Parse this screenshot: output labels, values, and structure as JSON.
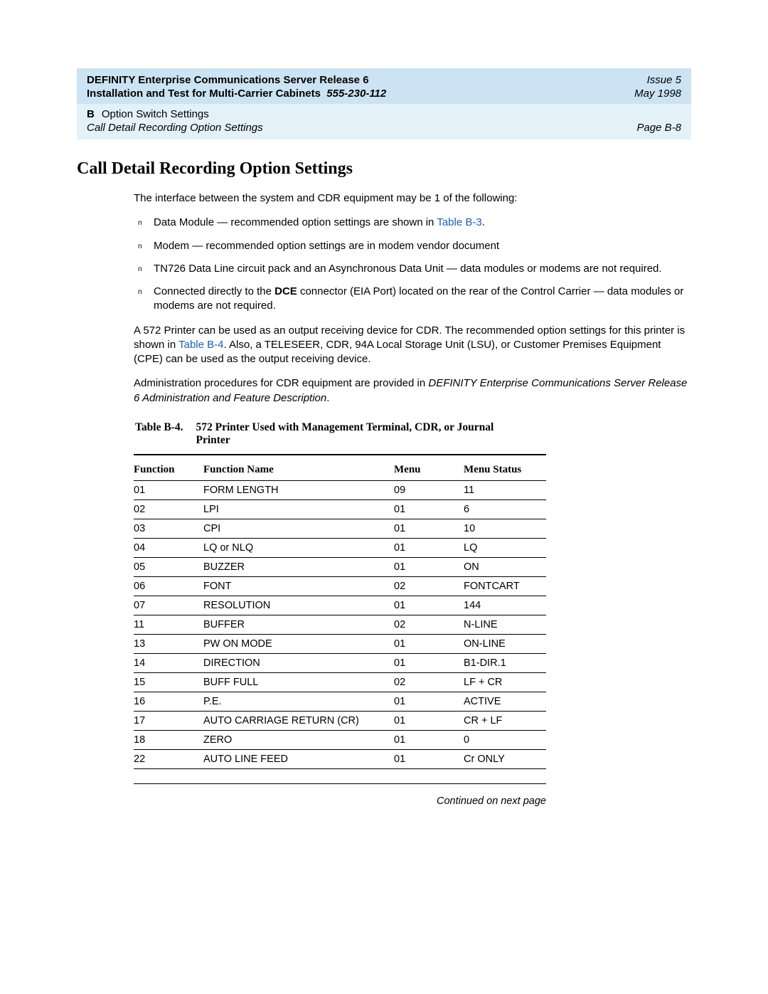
{
  "header": {
    "title_main": "DEFINITY Enterprise Communications Server Release 6",
    "issue": "Issue 5",
    "subtitle": "Installation and Test for Multi-Carrier Cabinets",
    "docnum": "555-230-112",
    "date": "May 1998",
    "appendix_letter": "B",
    "appendix_title": "Option Switch Settings",
    "breadcrumb": "Call Detail Recording Option Settings",
    "page": "Page B-8"
  },
  "section_title": "Call Detail Recording Option Settings",
  "intro_p": "The interface between the system and CDR equipment may be 1 of the following:",
  "bullets": [
    {
      "prefix": "Data Module",
      "dash": " — ",
      "rest_a": "recommended option settings are shown in ",
      "link": "Table B-3",
      "rest_b": "."
    },
    {
      "prefix": "Modem",
      "dash": " — ",
      "rest_a": "recommended option settings are in modem vendor document",
      "link": "",
      "rest_b": ""
    },
    {
      "prefix": "TN726 Data Line circuit pack and an Asynchronous Data Unit",
      "dash": " — ",
      "rest_a": "data modules or modems are not required.",
      "link": "",
      "rest_b": ""
    },
    {
      "prefix": "Connected directly to the ",
      "bold_inline": "DCE",
      "mid": " connector (EIA Port) located on the rear of the Control Carrier",
      "dash": " — ",
      "rest_a": "data modules or modems are not required.",
      "link": "",
      "rest_b": ""
    }
  ],
  "para2_a": "A 572 Printer can be used as an output receiving device for CDR. The recommended option settings for this printer is shown in ",
  "para2_link": "Table B-4",
  "para2_b": ". Also, a TELESEER, CDR, 94A Local Storage Unit (LSU), or Customer Premises Equipment (CPE) can be used as the output receiving device.",
  "para3_a": "Administration procedures for CDR equipment are provided in ",
  "para3_i": "DEFINITY Enterprise Communications Server Release 6 Administration and Feature Description",
  "para3_b": ".",
  "table": {
    "number": "Table B-4.",
    "title": "572 Printer Used with Management Terminal, CDR, or Journal Printer",
    "headers": [
      "Function",
      "Function Name",
      "Menu",
      "Menu Status"
    ],
    "rows": [
      [
        "01",
        "FORM LENGTH",
        "09",
        "11"
      ],
      [
        "02",
        "LPI",
        "01",
        "6"
      ],
      [
        "03",
        "CPI",
        "01",
        "10"
      ],
      [
        "04",
        "LQ or NLQ",
        "01",
        "LQ"
      ],
      [
        "05",
        "BUZZER",
        "01",
        "ON"
      ],
      [
        "06",
        "FONT",
        "02",
        "FONTCART"
      ],
      [
        "07",
        "RESOLUTION",
        "01",
        "144"
      ],
      [
        "11",
        "BUFFER",
        "02",
        "N-LINE"
      ],
      [
        "13",
        "PW ON MODE",
        "01",
        "ON-LINE"
      ],
      [
        "14",
        "DIRECTION",
        "01",
        "B1-DIR.1"
      ],
      [
        "15",
        "BUFF FULL",
        "02",
        "LF + CR"
      ],
      [
        "16",
        "P.E.",
        "01",
        "ACTIVE"
      ],
      [
        "17",
        "AUTO CARRIAGE RETURN (CR)",
        "01",
        "CR + LF"
      ],
      [
        "18",
        "ZERO",
        "01",
        "0"
      ],
      [
        "22",
        "AUTO LINE FEED",
        "01",
        "Cr ONLY"
      ]
    ]
  },
  "continued": "Continued on next page"
}
